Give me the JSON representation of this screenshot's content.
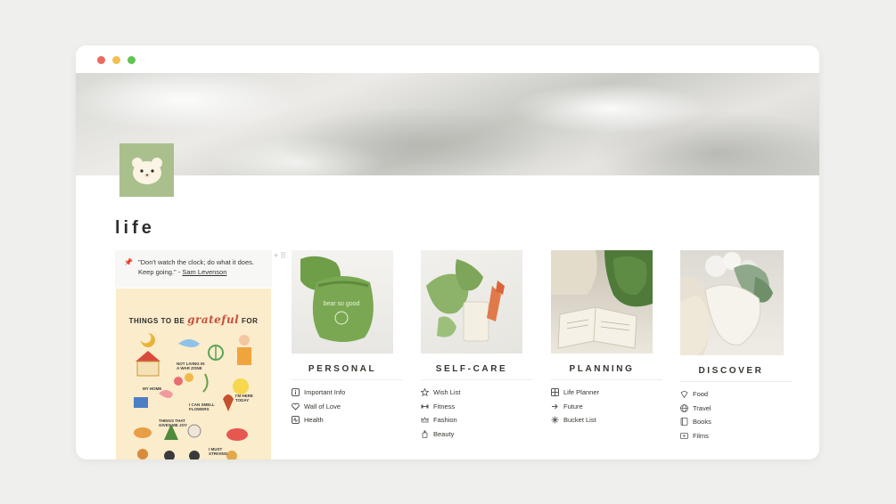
{
  "window": {
    "controls": [
      "close",
      "minimize",
      "zoom"
    ]
  },
  "page": {
    "title": "life",
    "icon": "bear-face-icon",
    "cover": "white-fabric-cover"
  },
  "quote": {
    "text": "\"Don't watch the clock; do what it does. Keep going.\" - ",
    "author": "Sam Levenson",
    "icon": "pushpin-icon"
  },
  "poster": {
    "title_prefix": "THINGS TO BE ",
    "title_script": "grateful",
    "title_suffix": " FOR",
    "labels": {
      "home": "MY HOME",
      "war": "NOT LIVING IN A WAR ZONE",
      "flowers": "I CAN SMELL FLOWERS",
      "here": "I'M HERE TODAY",
      "joy": "THINGS THAT GIVES ME JOY",
      "striving": "I MUST STRIVING"
    }
  },
  "gallery": [
    {
      "title": "PERSONAL",
      "links": [
        {
          "label": "Important Info",
          "icon": "info-icon"
        },
        {
          "label": "Wall of Love",
          "icon": "heart-icon"
        },
        {
          "label": "Health",
          "icon": "pulse-icon"
        }
      ]
    },
    {
      "title": "SELF-CARE",
      "links": [
        {
          "label": "Wish List",
          "icon": "star-icon"
        },
        {
          "label": "Fitness",
          "icon": "dumbbell-icon"
        },
        {
          "label": "Fashion",
          "icon": "crown-icon"
        },
        {
          "label": "Beauty",
          "icon": "lotion-icon"
        }
      ]
    },
    {
      "title": "PLANNING",
      "links": [
        {
          "label": "Life Planner",
          "icon": "planner-icon"
        },
        {
          "label": "Future",
          "icon": "arrow-icon"
        },
        {
          "label": "Bucket List",
          "icon": "sparkle-icon"
        }
      ]
    },
    {
      "title": "DISCOVER",
      "links": [
        {
          "label": "Food",
          "icon": "food-icon"
        },
        {
          "label": "Travel",
          "icon": "globe-icon"
        },
        {
          "label": "Books",
          "icon": "book-icon"
        },
        {
          "label": "Films",
          "icon": "film-icon"
        }
      ]
    }
  ]
}
